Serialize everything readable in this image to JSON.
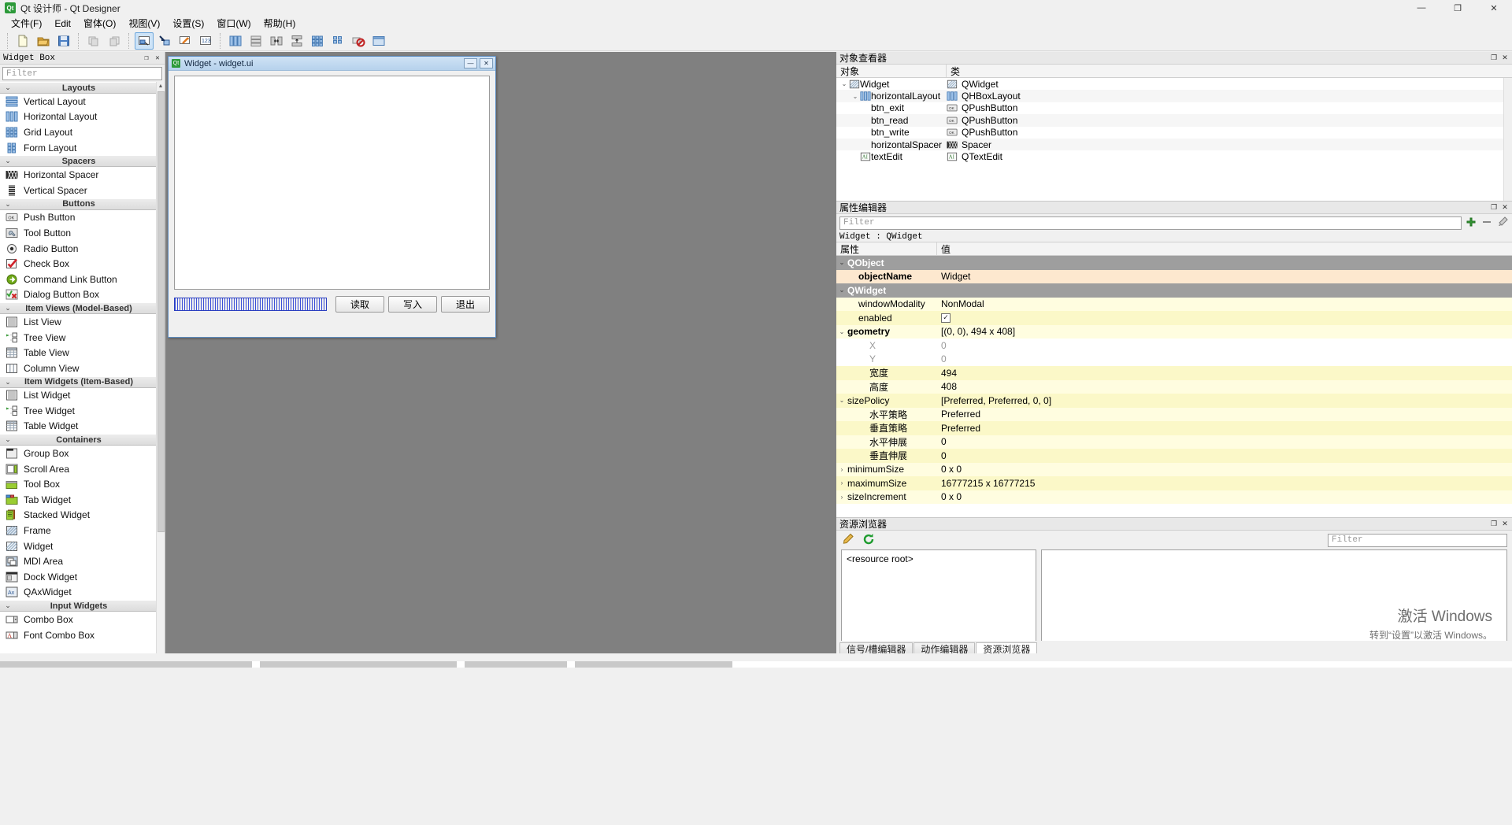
{
  "window": {
    "title": "Qt 设计师 - Qt Designer",
    "app_icon": "qt-designer-icon",
    "minimize": "—",
    "maximize": "❐",
    "close": "✕"
  },
  "menubar": {
    "items": [
      {
        "label": "文件(F)",
        "name": "menu-file"
      },
      {
        "label": "Edit",
        "name": "menu-edit"
      },
      {
        "label": "窗体(O)",
        "name": "menu-form"
      },
      {
        "label": "视图(V)",
        "name": "menu-view"
      },
      {
        "label": "设置(S)",
        "name": "menu-settings"
      },
      {
        "label": "窗口(W)",
        "name": "menu-window"
      },
      {
        "label": "帮助(H)",
        "name": "menu-help"
      }
    ]
  },
  "toolbar": {
    "buttons": [
      {
        "name": "new-form-icon",
        "title": "新建"
      },
      {
        "name": "open-form-icon",
        "title": "打开"
      },
      {
        "name": "save-form-icon",
        "title": "保存"
      },
      {
        "name": "undo-icon",
        "title": "撤销"
      },
      {
        "name": "redo-icon",
        "title": "重做"
      },
      {
        "name": "edit-widgets-icon",
        "title": "编辑控件",
        "active": true
      },
      {
        "name": "edit-signals-slots-icon",
        "title": "编辑信号/槽"
      },
      {
        "name": "edit-buddies-icon",
        "title": "编辑伙伴"
      },
      {
        "name": "edit-tab-order-icon",
        "title": "编辑Tab顺序"
      },
      {
        "name": "layout-horizontal-icon",
        "title": "水平布局"
      },
      {
        "name": "layout-vertical-icon",
        "title": "垂直布局"
      },
      {
        "name": "layout-splitter-h-icon",
        "title": "水平分裂器布局"
      },
      {
        "name": "layout-splitter-v-icon",
        "title": "垂直分裂器布局"
      },
      {
        "name": "layout-grid-icon",
        "title": "栅格布局"
      },
      {
        "name": "layout-form-icon",
        "title": "表单布局"
      },
      {
        "name": "break-layout-icon",
        "title": "打破布局"
      },
      {
        "name": "preview-icon",
        "title": "预览"
      }
    ]
  },
  "widget_box": {
    "title": "Widget Box",
    "filter_placeholder": "Filter",
    "dock_buttons": {
      "float": "❐",
      "close": "✕"
    },
    "groups": [
      {
        "label": "Layouts",
        "name": "widget-group-layouts",
        "items": [
          {
            "label": "Vertical Layout",
            "icon": "vertical-layout-icon"
          },
          {
            "label": "Horizontal Layout",
            "icon": "horizontal-layout-icon"
          },
          {
            "label": "Grid Layout",
            "icon": "grid-layout-icon"
          },
          {
            "label": "Form Layout",
            "icon": "form-layout-icon"
          }
        ]
      },
      {
        "label": "Spacers",
        "name": "widget-group-spacers",
        "items": [
          {
            "label": "Horizontal Spacer",
            "icon": "horizontal-spacer-icon"
          },
          {
            "label": "Vertical Spacer",
            "icon": "vertical-spacer-icon"
          }
        ]
      },
      {
        "label": "Buttons",
        "name": "widget-group-buttons",
        "items": [
          {
            "label": "Push Button",
            "icon": "push-button-icon"
          },
          {
            "label": "Tool Button",
            "icon": "tool-button-icon"
          },
          {
            "label": "Radio Button",
            "icon": "radio-button-icon"
          },
          {
            "label": "Check Box",
            "icon": "check-box-icon"
          },
          {
            "label": "Command Link Button",
            "icon": "command-link-button-icon"
          },
          {
            "label": "Dialog Button Box",
            "icon": "dialog-button-box-icon"
          }
        ]
      },
      {
        "label": "Item Views (Model-Based)",
        "name": "widget-group-item-views",
        "items": [
          {
            "label": "List View",
            "icon": "list-view-icon"
          },
          {
            "label": "Tree View",
            "icon": "tree-view-icon"
          },
          {
            "label": "Table View",
            "icon": "table-view-icon"
          },
          {
            "label": "Column View",
            "icon": "column-view-icon"
          }
        ]
      },
      {
        "label": "Item Widgets (Item-Based)",
        "name": "widget-group-item-widgets",
        "items": [
          {
            "label": "List Widget",
            "icon": "list-widget-icon"
          },
          {
            "label": "Tree Widget",
            "icon": "tree-widget-icon"
          },
          {
            "label": "Table Widget",
            "icon": "table-widget-icon"
          }
        ]
      },
      {
        "label": "Containers",
        "name": "widget-group-containers",
        "items": [
          {
            "label": "Group Box",
            "icon": "group-box-icon"
          },
          {
            "label": "Scroll Area",
            "icon": "scroll-area-icon"
          },
          {
            "label": "Tool Box",
            "icon": "tool-box-icon"
          },
          {
            "label": "Tab Widget",
            "icon": "tab-widget-icon"
          },
          {
            "label": "Stacked Widget",
            "icon": "stacked-widget-icon"
          },
          {
            "label": "Frame",
            "icon": "frame-icon"
          },
          {
            "label": "Widget",
            "icon": "widget-icon"
          },
          {
            "label": "MDI Area",
            "icon": "mdi-area-icon"
          },
          {
            "label": "Dock Widget",
            "icon": "dock-widget-icon"
          },
          {
            "label": "QAxWidget",
            "icon": "qaxwidget-icon"
          }
        ]
      },
      {
        "label": "Input Widgets",
        "name": "widget-group-input-widgets",
        "items": [
          {
            "label": "Combo Box",
            "icon": "combo-box-icon"
          },
          {
            "label": "Font Combo Box",
            "icon": "font-combo-box-icon"
          }
        ]
      }
    ]
  },
  "form_window": {
    "title": "Widget - widget.ui",
    "icon": "qt-form-icon",
    "buttons": {
      "minimize": "—",
      "close": "✕"
    },
    "text_edit": {
      "name": "textEdit",
      "value": ""
    },
    "spacer": {
      "name": "horizontalSpacer"
    },
    "buttons_row": [
      {
        "label": "读取",
        "name": "btn_read"
      },
      {
        "label": "写入",
        "name": "btn_write"
      },
      {
        "label": "退出",
        "name": "btn_exit"
      }
    ]
  },
  "object_inspector": {
    "title": "对象查看器",
    "dock_buttons": {
      "float": "❐",
      "close": "✕"
    },
    "columns": [
      "对象",
      "类"
    ],
    "rows": [
      {
        "name": "Widget",
        "class": "QWidget",
        "indent": 0,
        "expander": "⌄",
        "icon": "widget-icon"
      },
      {
        "name": "horizontalLayout",
        "class": "QHBoxLayout",
        "indent": 1,
        "expander": "⌄",
        "icon": "horizontal-layout-icon"
      },
      {
        "name": "btn_exit",
        "class": "QPushButton",
        "indent": 2,
        "expander": "",
        "icon": "push-button-icon"
      },
      {
        "name": "btn_read",
        "class": "QPushButton",
        "indent": 2,
        "expander": "",
        "icon": "push-button-icon"
      },
      {
        "name": "btn_write",
        "class": "QPushButton",
        "indent": 2,
        "expander": "",
        "icon": "push-button-icon"
      },
      {
        "name": "horizontalSpacer",
        "class": "Spacer",
        "indent": 2,
        "expander": "",
        "icon": "horizontal-spacer-icon"
      },
      {
        "name": "textEdit",
        "class": "QTextEdit",
        "indent": 1,
        "expander": "",
        "icon": "text-edit-icon"
      }
    ]
  },
  "property_editor": {
    "title": "属性编辑器",
    "dock_buttons": {
      "float": "❐",
      "close": "✕"
    },
    "filter_placeholder": "Filter",
    "object_line": "Widget : QWidget",
    "tools": {
      "add": "+",
      "remove": "—",
      "configure": "wrench-icon"
    },
    "columns": [
      "属性",
      "值"
    ],
    "rows": [
      {
        "kind": "group",
        "name": "QObject",
        "value": "",
        "expander": "⌄"
      },
      {
        "kind": "hl",
        "name": "objectName",
        "value": "Widget",
        "indent": 1,
        "bold": true
      },
      {
        "kind": "group",
        "name": "QWidget",
        "value": "",
        "expander": "⌄"
      },
      {
        "kind": "y1",
        "name": "windowModality",
        "value": "NonModal",
        "indent": 1
      },
      {
        "kind": "y2",
        "name": "enabled",
        "value": "checkbox-checked",
        "indent": 1,
        "is_check": true
      },
      {
        "kind": "y1",
        "name": "geometry",
        "value": "[(0, 0), 494 x 408]",
        "indent": 0,
        "expander": "⌄",
        "bold": true
      },
      {
        "kind": "dim",
        "name": "X",
        "value": "0",
        "indent": 2
      },
      {
        "kind": "dim",
        "name": "Y",
        "value": "0",
        "indent": 2
      },
      {
        "kind": "y2",
        "name": "宽度",
        "value": "494",
        "indent": 2
      },
      {
        "kind": "y1",
        "name": "高度",
        "value": "408",
        "indent": 2
      },
      {
        "kind": "y2",
        "name": "sizePolicy",
        "value": "[Preferred, Preferred, 0, 0]",
        "indent": 0,
        "expander": "⌄"
      },
      {
        "kind": "y1",
        "name": "水平策略",
        "value": "Preferred",
        "indent": 2
      },
      {
        "kind": "y2",
        "name": "垂直策略",
        "value": "Preferred",
        "indent": 2
      },
      {
        "kind": "y1",
        "name": "水平伸展",
        "value": "0",
        "indent": 2
      },
      {
        "kind": "y2",
        "name": "垂直伸展",
        "value": "0",
        "indent": 2
      },
      {
        "kind": "y1",
        "name": "minimumSize",
        "value": "0 x 0",
        "indent": 0,
        "expander": "›"
      },
      {
        "kind": "y2",
        "name": "maximumSize",
        "value": "16777215 x 16777215",
        "indent": 0,
        "expander": "›"
      },
      {
        "kind": "y1",
        "name": "sizeIncrement",
        "value": "0 x 0",
        "indent": 0,
        "expander": "›"
      }
    ]
  },
  "resource_browser": {
    "title": "资源浏览器",
    "dock_buttons": {
      "float": "❐",
      "close": "✕"
    },
    "edit_icon": "pencil-icon",
    "reload_icon": "reload-icon",
    "filter_placeholder": "Filter",
    "root_label": "<resource root>"
  },
  "bottom_tabs": [
    {
      "label": "信号/槽编辑器",
      "name": "tab-signal-slot-editor",
      "active": false
    },
    {
      "label": "动作编辑器",
      "name": "tab-action-editor",
      "active": false
    },
    {
      "label": "资源浏览器",
      "name": "tab-resource-browser",
      "active": true
    }
  ],
  "watermark": {
    "line1": "激活 Windows",
    "line2": "转到“设置”以激活 Windows。"
  }
}
